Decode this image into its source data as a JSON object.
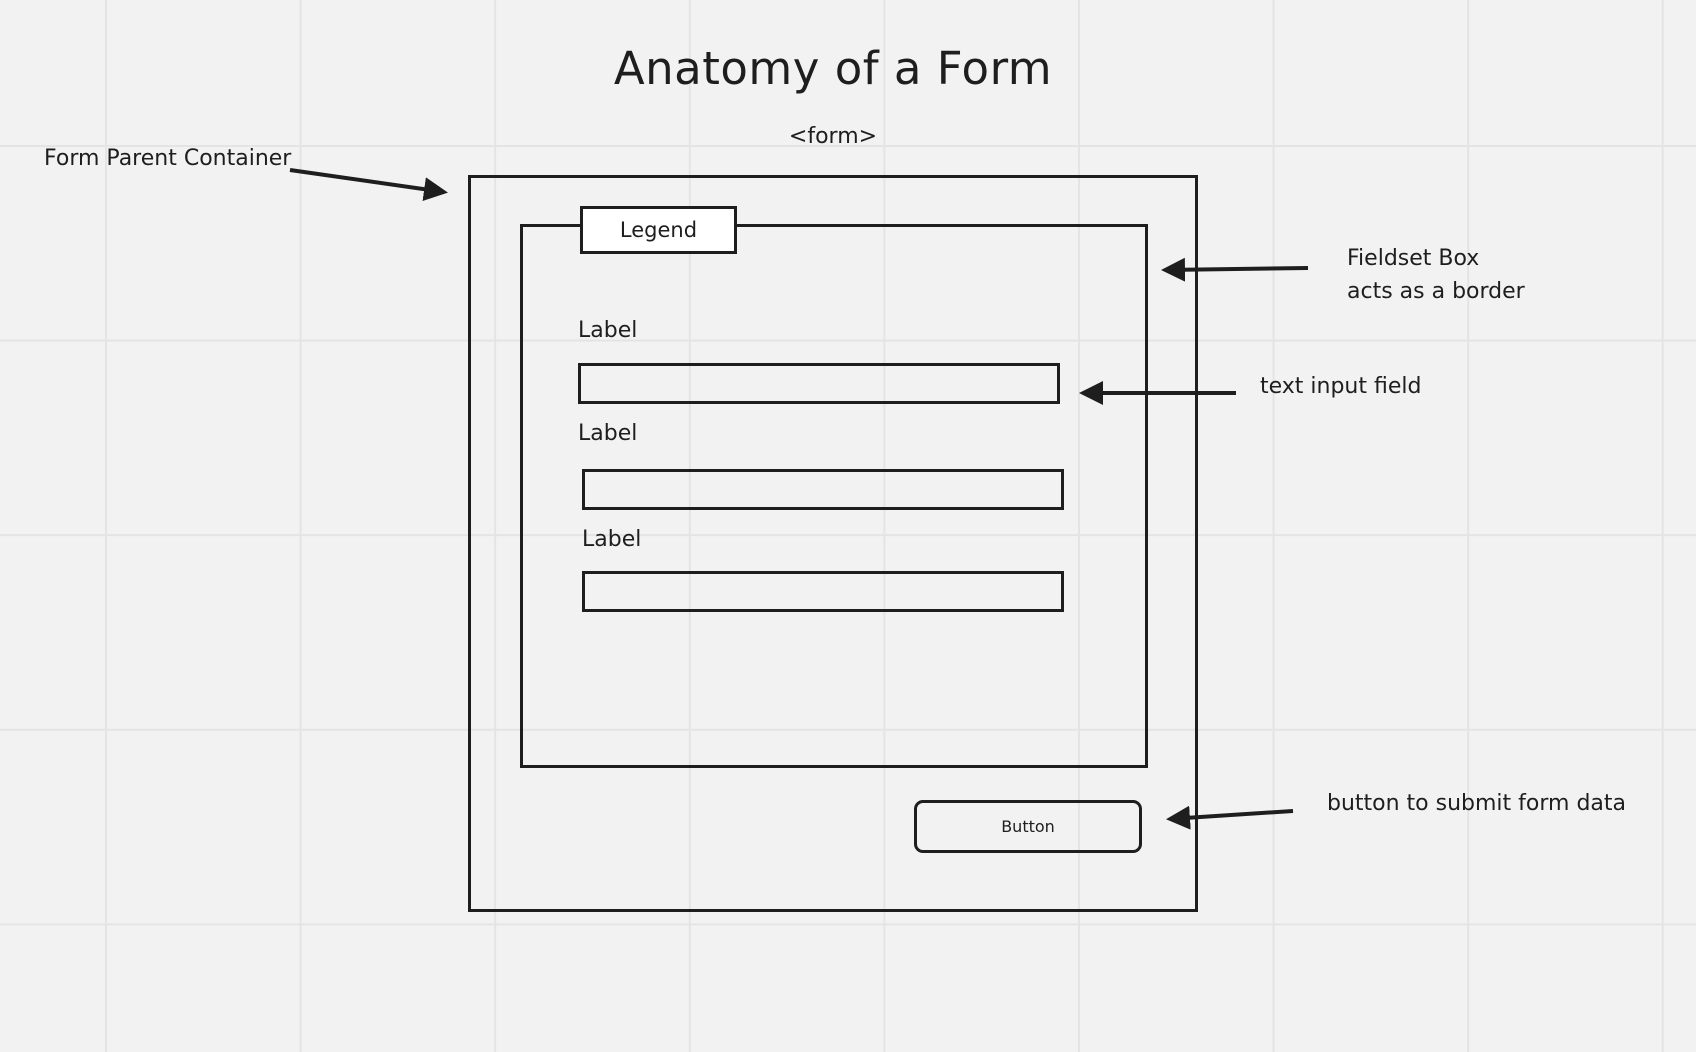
{
  "diagram": {
    "title": "Anatomy of a Form",
    "form_tag": "<form>",
    "legend": "Legend",
    "fields": [
      {
        "label": "Label"
      },
      {
        "label": "Label"
      },
      {
        "label": "Label"
      }
    ],
    "button_label": "Button",
    "annotations": {
      "form_parent_container": "Form Parent Container",
      "fieldset_line1": "Fieldset Box",
      "fieldset_line2": "acts as a border",
      "text_input_field": "text input field",
      "button_note": "button to submit form data"
    }
  }
}
